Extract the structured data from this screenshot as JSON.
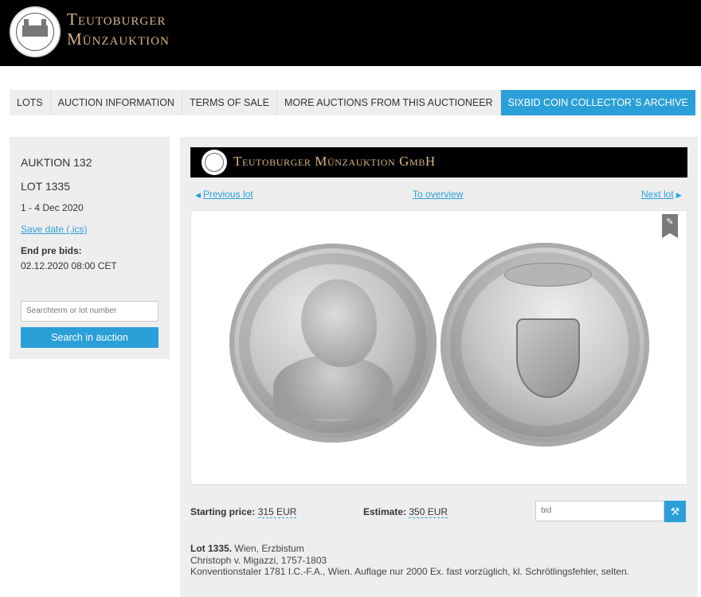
{
  "header": {
    "brand_line1": "Teutoburger",
    "brand_line2": "Münzauktion",
    "logo_icon": "castle-seal-icon"
  },
  "nav": {
    "items": [
      {
        "label": "LOTS"
      },
      {
        "label": "AUCTION INFORMATION"
      },
      {
        "label": "TERMS OF SALE"
      },
      {
        "label": "MORE AUCTIONS FROM THIS AUCTIONEER"
      },
      {
        "label": "SIXBID COIN COLLECTOR`S ARCHIVE"
      }
    ],
    "active_color": "#2b9fd8"
  },
  "sidebar": {
    "auction": "AUKTION 132",
    "lot": "LOT 1335",
    "date": "1 - 4 Dec 2020",
    "save_date": "Save date (.ics)",
    "end_label": "End pre bids:",
    "end_value": "02.12.2020 08:00 CET",
    "search_placeholder": "Searchterm or lot number",
    "search_button": "Search in auction"
  },
  "main": {
    "banner_text": "Teutoburger Münzauktion GmbH",
    "previous_lot": "Previous lot",
    "overview": "To overview",
    "next_lot": "Next lot",
    "badge_icon": "no-photo-icon",
    "starting_price_label": "Starting price:",
    "starting_price_value": "315 EUR",
    "estimate_label": "Estimate:",
    "estimate_value": "350 EUR",
    "bid_placeholder": "bid",
    "bid_icon": "gavel-icon",
    "lot_title": "Lot 1335.",
    "lot_line1": "Wien, Erzbistum",
    "lot_line2": "Christoph v. Migazzi, 1757-1803",
    "lot_line3": "Konventionstaler 1781 I.C.-F.A., Wien. Auflage nur 2000 Ex. fast vorzüglich, kl. Schrötlingsfehler, selten."
  }
}
